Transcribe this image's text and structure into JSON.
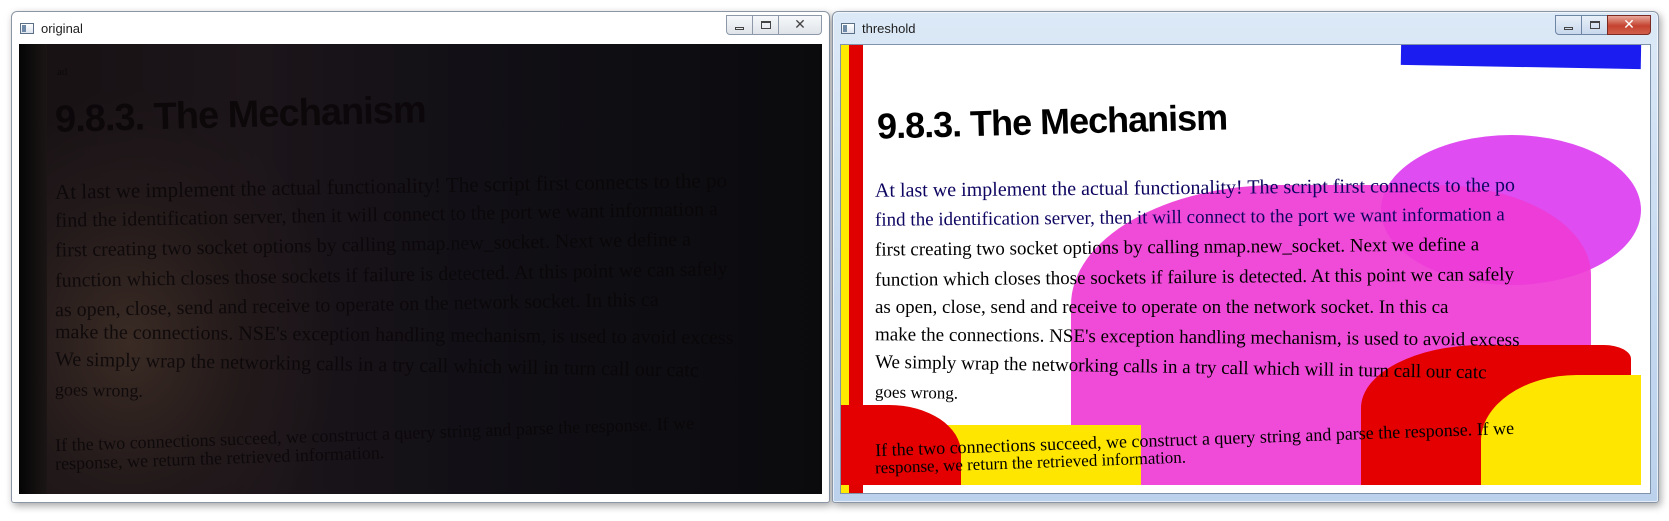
{
  "windows": [
    {
      "title": "original",
      "controls": {
        "minimize": "minimize",
        "maximize": "maximize",
        "close": "close"
      }
    },
    {
      "title": "threshold",
      "controls": {
        "minimize": "minimize",
        "maximize": "maximize",
        "close": "close"
      }
    }
  ],
  "document": {
    "page_mark": "ad",
    "heading": "9.8.3. The Mechanism",
    "lines": [
      "At last we implement the actual functionality! The script first connects to the po",
      "find the identification server, then it will connect to the port we want information a",
      "first creating two socket options by calling nmap.new_socket. Next we define a",
      "function which closes those sockets if failure is detected. At this point we can safely",
      "as open, close, send and receive to operate on the network socket. In this ca",
      "make the connections. NSE's exception handling mechanism, is used to avoid excess",
      "We simply wrap the networking calls in a try call which will in turn call our catc",
      "goes wrong.",
      "If the two connections succeed, we construct a query string and parse the response. If we",
      "response, we return the retrieved information."
    ]
  },
  "colors": {
    "threshold_blue": "#1a1cf0",
    "threshold_magenta": "#ef3bd6",
    "threshold_red": "#e40000",
    "threshold_yellow": "#ffe600",
    "close_button": "#c4422f"
  }
}
